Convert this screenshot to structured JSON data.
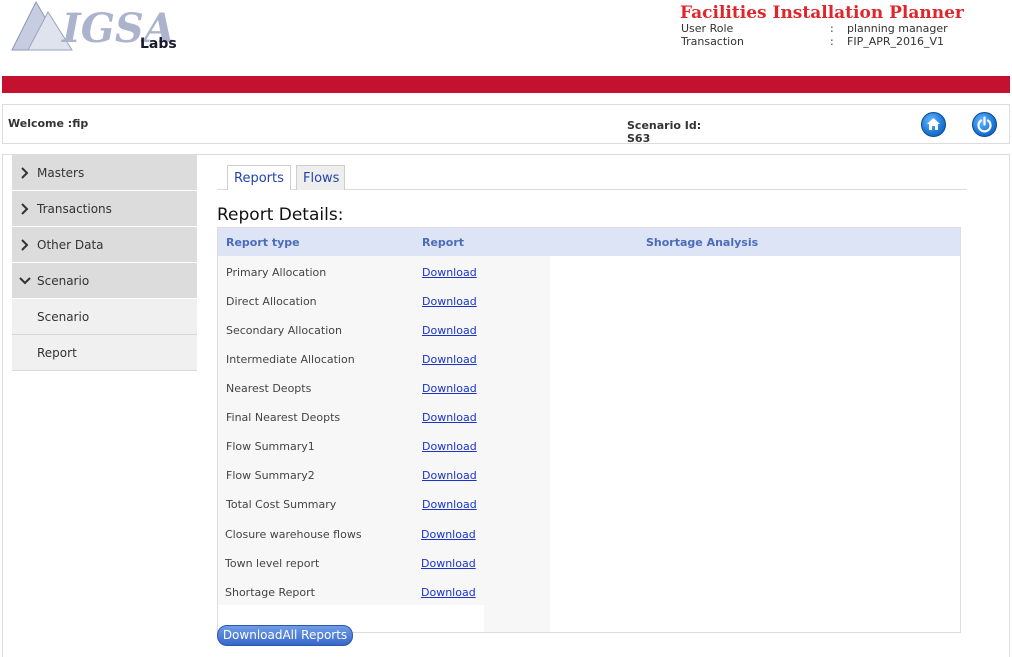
{
  "header": {
    "logo_text": "IGSA Labs",
    "app_title": "Facilities Installation Planner",
    "user_role_label": "User Role",
    "user_role_value": "planning manager",
    "transaction_label": "Transaction",
    "transaction_value": "FIP_APR_2016_V1",
    "separator": ":"
  },
  "welcome_bar": {
    "welcome_text": "Welcome :fip",
    "scenario_label": "Scenario Id:",
    "scenario_value": "S63",
    "home_icon": "home-icon",
    "power_icon": "power-icon"
  },
  "sidebar": {
    "items": [
      {
        "label": "Masters",
        "icon": "chevron-right-icon"
      },
      {
        "label": "Transactions",
        "icon": "chevron-right-icon"
      },
      {
        "label": "Other Data",
        "icon": "chevron-right-icon"
      },
      {
        "label": "Scenario",
        "icon": "chevron-down-icon"
      }
    ],
    "sub_items": [
      {
        "label": "Scenario"
      },
      {
        "label": "Report"
      }
    ]
  },
  "tabs": [
    {
      "label": "Reports",
      "active": true
    },
    {
      "label": "Flows",
      "active": false
    }
  ],
  "main": {
    "heading": "Report Details:",
    "columns": [
      "Report type",
      "Report",
      "Shortage Analysis"
    ],
    "rows": [
      {
        "type": "Primary Allocation",
        "link": "Download"
      },
      {
        "type": "Direct Allocation",
        "link": "Download"
      },
      {
        "type": "Secondary Allocation",
        "link": "Download"
      },
      {
        "type": "Intermediate Allocation",
        "link": "Download"
      },
      {
        "type": "Nearest Deopts",
        "link": "Download"
      },
      {
        "type": "Final Nearest Deopts",
        "link": "Download"
      },
      {
        "type": "Flow Summary1",
        "link": "Download"
      },
      {
        "type": "Flow Summary2",
        "link": "Download"
      },
      {
        "type": "Total Cost Summary",
        "link": "Download"
      },
      {
        "type": "Closure warehouse flows",
        "link": "Download"
      },
      {
        "type": "Town level report",
        "link": "Download"
      },
      {
        "type": "Shortage Report",
        "link": "Download"
      }
    ],
    "download_all_label": "DownloadAll Reports"
  },
  "colors": {
    "brand_red": "#c3112f",
    "title_red": "#e0262b",
    "link_blue": "#1a33cc",
    "header_blue": "#4a6cba",
    "button_blue": "#3668c9"
  }
}
